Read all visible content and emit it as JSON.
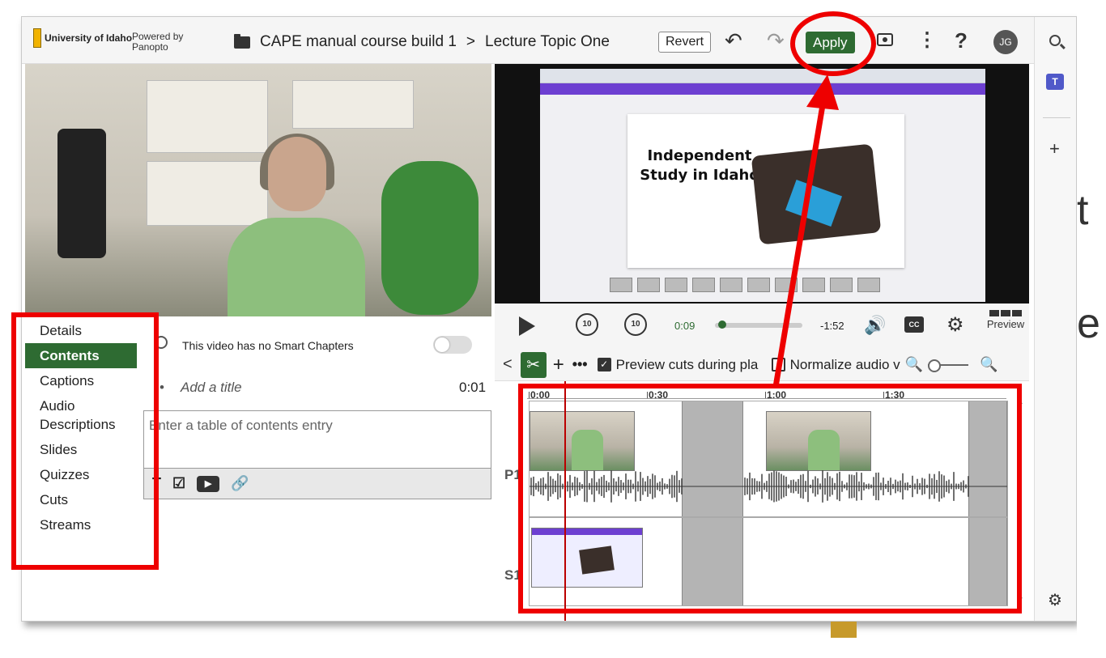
{
  "header": {
    "logo_text": "University of Idaho",
    "powered_by": "Powered by Panopto",
    "breadcrumb_folder": "CAPE manual course build 1",
    "breadcrumb_separator": ">",
    "breadcrumb_session": "Lecture Topic One",
    "revert_label": "Revert",
    "apply_label": "Apply",
    "avatar_initials": "JG"
  },
  "slide": {
    "title": "Independent Study in Idaho"
  },
  "player": {
    "current_time": "0:09",
    "remaining_time": "-1:52",
    "progress": 0.07,
    "skip_back": "10",
    "skip_fwd": "10",
    "cc_label": "CC",
    "preview_label": "Preview"
  },
  "timeline_toolbar": {
    "preview_cuts_label": "Preview cuts during pla",
    "preview_cuts_checked": true,
    "normalize_label": "Normalize audio v",
    "normalize_checked": false
  },
  "timeline": {
    "ruler_ticks": [
      "0:00",
      "0:30",
      "1:00",
      "1:30"
    ],
    "tracks": [
      "P1",
      "S1"
    ]
  },
  "menu": {
    "items": [
      "Details",
      "Contents",
      "Captions",
      "Audio Descriptions",
      "Slides",
      "Quizzes",
      "Cuts",
      "Streams"
    ],
    "active": "Contents"
  },
  "contents": {
    "smart_chapters_text": "This video has no Smart Chapters",
    "bullet": "•",
    "title_placeholder": "Add a title",
    "title_time": "0:01",
    "toc_placeholder": "Enter a table of contents entry"
  },
  "colors": {
    "accent": "#2e6b32",
    "annotation": "#ee0000"
  },
  "icons": [
    "folder-icon",
    "undo-icon",
    "redo-icon",
    "eye-icon",
    "kebab-icon",
    "help-icon",
    "search-icon",
    "teams-icon",
    "plus-icon",
    "gear-icon",
    "play-icon",
    "rewind-10-icon",
    "forward-10-icon",
    "volume-icon",
    "cc-icon",
    "settings-icon",
    "scissors-icon",
    "zoom-out-icon",
    "zoom-in-icon",
    "text-format-icon",
    "quiz-icon",
    "youtube-icon",
    "link-icon"
  ]
}
